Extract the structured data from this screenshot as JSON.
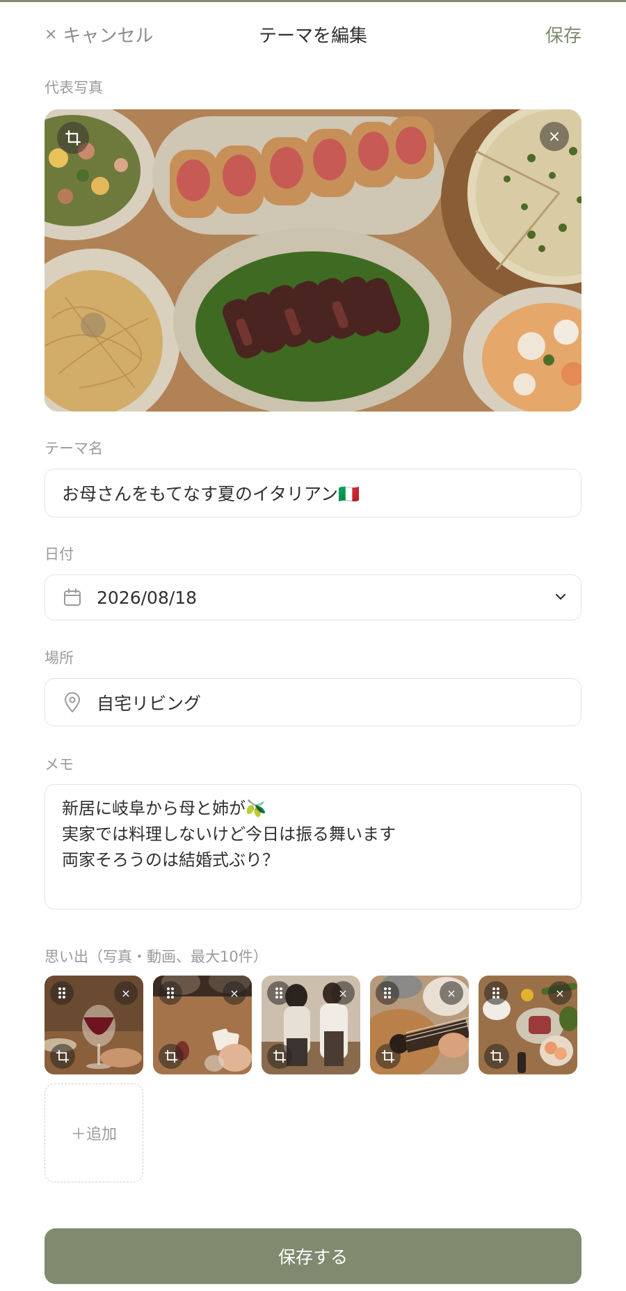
{
  "header": {
    "cancel_icon": "close-icon",
    "cancel_label": "キャンセル",
    "title": "テーマを編集",
    "save_label": "保存"
  },
  "cover_photo": {
    "label": "代表写真",
    "crop_icon": "crop-icon",
    "remove_icon": "close-icon"
  },
  "theme_name": {
    "label": "テーマ名",
    "value": "お母さんをもてなす夏のイタリアン🇮🇹"
  },
  "date": {
    "label": "日付",
    "value": "2026/08/18",
    "icon": "calendar-icon",
    "dropdown_icon": "chevron-down-icon"
  },
  "place": {
    "label": "場所",
    "value": "自宅リビング",
    "icon": "location-pin-icon"
  },
  "memo": {
    "label": "メモ",
    "lines": [
      "新居に岐阜から母と姉が🫒",
      "実家では料理しないけど今日は振る舞います",
      "両家そろうのは結婚式ぶり？"
    ]
  },
  "memories": {
    "label": "思い出（写真・動画、最大10件）",
    "items": [
      {
        "subject": "wine glass at dinner"
      },
      {
        "subject": "card game on table"
      },
      {
        "subject": "people in kitchen"
      },
      {
        "subject": "guitar"
      },
      {
        "subject": "table with food"
      }
    ],
    "add_label": "＋追加"
  },
  "footer": {
    "save_button_label": "保存する"
  },
  "colors": {
    "accent": "#7f8a6e",
    "label_gray": "#9a9a9a",
    "border": "#e3e3e3"
  }
}
